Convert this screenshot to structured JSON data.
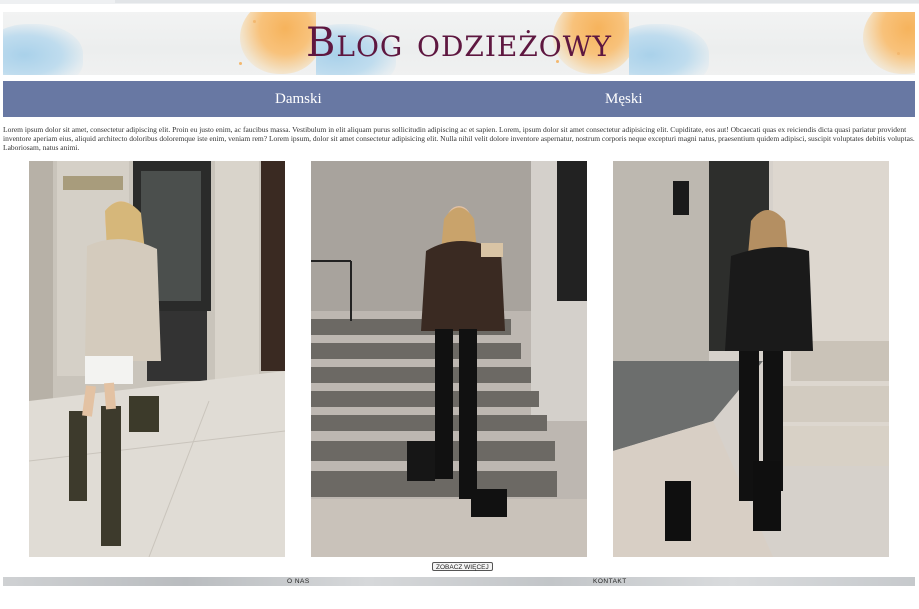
{
  "header": {
    "title": "Blog odzieżowy"
  },
  "nav": {
    "items": [
      {
        "label": "Damski"
      },
      {
        "label": "Męski"
      }
    ]
  },
  "intro": {
    "text": "Lorem ipsum dolor sit amet, consectetur adipiscing elit. Proin eu justo enim, ac faucibus massa. Vestibulum in elit aliquam purus sollicitudin adipiscing ac et sapien. Lorem, ipsum dolor sit amet consectetur adipisicing elit. Cupiditate, eos aut! Obcaecati quas ex reiciendis dicta quasi pariatur provident inventore aperiam eius, aliquid architecto doloribus doloremque iste enim, veniam rem? Lorem ipsum, dolor sit amet consectetur adipisicing elit. Nulla nihil velit dolore inventore aspernatur, nostrum corporis neque excepturi magni natus, praesentium quidem adipisci, suscipit voluptates debitis voluptas. Laboriosam, natus animi."
  },
  "gallery": {
    "photos": [
      {
        "icon": "woman-beige-sweater-photo"
      },
      {
        "icon": "woman-leather-jacket-stairs-photo"
      },
      {
        "icon": "woman-black-jacket-column-photo"
      }
    ]
  },
  "actions": {
    "more_label": "ZOBACZ WIĘCEJ"
  },
  "footer": {
    "links": [
      {
        "label": "O NAS"
      },
      {
        "label": "KONTAKT"
      }
    ]
  },
  "colors": {
    "nav_bg": "#6878a3",
    "title": "#5e1740",
    "accent_orange": "#f6b35c",
    "accent_blue": "#a9d1ea"
  }
}
